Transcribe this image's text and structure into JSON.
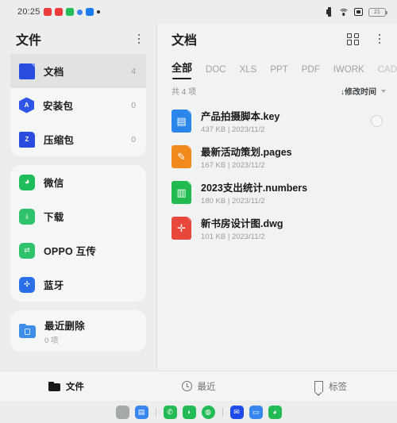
{
  "status_bar": {
    "clock": "20:25",
    "app_dots": [
      {
        "name": "notification-icon-1",
        "color": "#ee3b3b"
      },
      {
        "name": "notification-icon-2",
        "color": "#ee3b3b"
      },
      {
        "name": "notification-icon-3",
        "color": "#22bb55"
      },
      {
        "name": "notification-icon-4",
        "color": "#3a86f0"
      },
      {
        "name": "notification-icon-5",
        "color": "#1f7bf0"
      }
    ],
    "battery_level": "21"
  },
  "left_pane": {
    "title": "文件",
    "groups": [
      {
        "items": [
          {
            "label": "文档",
            "count": "4",
            "icon": "document-icon",
            "selected": true
          },
          {
            "label": "安装包",
            "count": "0",
            "icon": "apk-icon",
            "selected": false
          },
          {
            "label": "压缩包",
            "count": "0",
            "icon": "zip-icon",
            "selected": false
          }
        ]
      },
      {
        "items": [
          {
            "label": "微信",
            "count": "",
            "icon": "wechat-icon",
            "selected": false
          },
          {
            "label": "下载",
            "count": "",
            "icon": "download-icon",
            "selected": false
          },
          {
            "label": "OPPO 互传",
            "count": "",
            "icon": "oppo-share-icon",
            "selected": false
          },
          {
            "label": "蓝牙",
            "count": "",
            "icon": "bluetooth-icon",
            "selected": false
          }
        ]
      },
      {
        "items": [
          {
            "label": "最近删除",
            "sub": "0 项",
            "icon": "recently-deleted-icon",
            "selected": false
          }
        ]
      }
    ]
  },
  "right_pane": {
    "title": "文档",
    "tabs": [
      {
        "label": "全部",
        "active": true
      },
      {
        "label": "DOC",
        "active": false
      },
      {
        "label": "XLS",
        "active": false
      },
      {
        "label": "PPT",
        "active": false
      },
      {
        "label": "PDF",
        "active": false
      },
      {
        "label": "IWORK",
        "active": false
      },
      {
        "label": "CAD",
        "active": false
      }
    ],
    "count_text": "共 4 项",
    "sort_label": "↓修改时间",
    "files": [
      {
        "name": "产品拍摄脚本.key",
        "size": "437 KB",
        "date": "2023/11/2",
        "meta": "437 KB  |  2023/11/2",
        "icon": "keynote-file-icon",
        "icon_color": "#2a86ea",
        "glyph": "▣",
        "checkbox_visible": true
      },
      {
        "name": "最新活动策划.pages",
        "size": "167 KB",
        "date": "2023/11/2",
        "meta": "167 KB  |  2023/11/2",
        "icon": "pages-file-icon",
        "icon_color": "#f08a1d",
        "glyph": "✎",
        "checkbox_visible": false
      },
      {
        "name": "2023支出统计.numbers",
        "size": "180 KB",
        "date": "2023/11/2",
        "meta": "180 KB  |  2023/11/2",
        "icon": "numbers-file-icon",
        "icon_color": "#20ba4e",
        "glyph": "▥",
        "checkbox_visible": false
      },
      {
        "name": "新书房设计图.dwg",
        "size": "101 KB",
        "date": "2023/11/2",
        "meta": "101 KB  |  2023/11/2",
        "icon": "dwg-file-icon",
        "icon_color": "#e8483c",
        "glyph": "✛",
        "checkbox_visible": false
      }
    ]
  },
  "bottom_nav": [
    {
      "label": "文件",
      "icon": "folder-icon",
      "active": true
    },
    {
      "label": "最近",
      "icon": "clock-icon",
      "active": false
    },
    {
      "label": "标签",
      "icon": "tag-icon",
      "active": false
    }
  ],
  "dock": [
    {
      "name": "app-drawer-icon",
      "color": "#a5a9a8",
      "glyph": ""
    },
    {
      "name": "file-manager-icon",
      "color": "#3a86f0",
      "glyph": "▤"
    },
    {
      "name": "dock-separator-1",
      "color": "",
      "glyph": ""
    },
    {
      "name": "phone-icon",
      "color": "#22bb55",
      "glyph": "✆"
    },
    {
      "name": "messages-icon",
      "color": "#22bb55",
      "glyph": "◗"
    },
    {
      "name": "browser-icon",
      "color": "#22bb55",
      "glyph": "◍"
    },
    {
      "name": "dock-separator-2",
      "color": "",
      "glyph": ""
    },
    {
      "name": "email-icon",
      "color": "#1f4bea",
      "glyph": "✉"
    },
    {
      "name": "gallery-folder-icon",
      "color": "#3a86f0",
      "glyph": "▭"
    },
    {
      "name": "wechat-icon",
      "color": "#22bb55",
      "glyph": "◕"
    }
  ]
}
